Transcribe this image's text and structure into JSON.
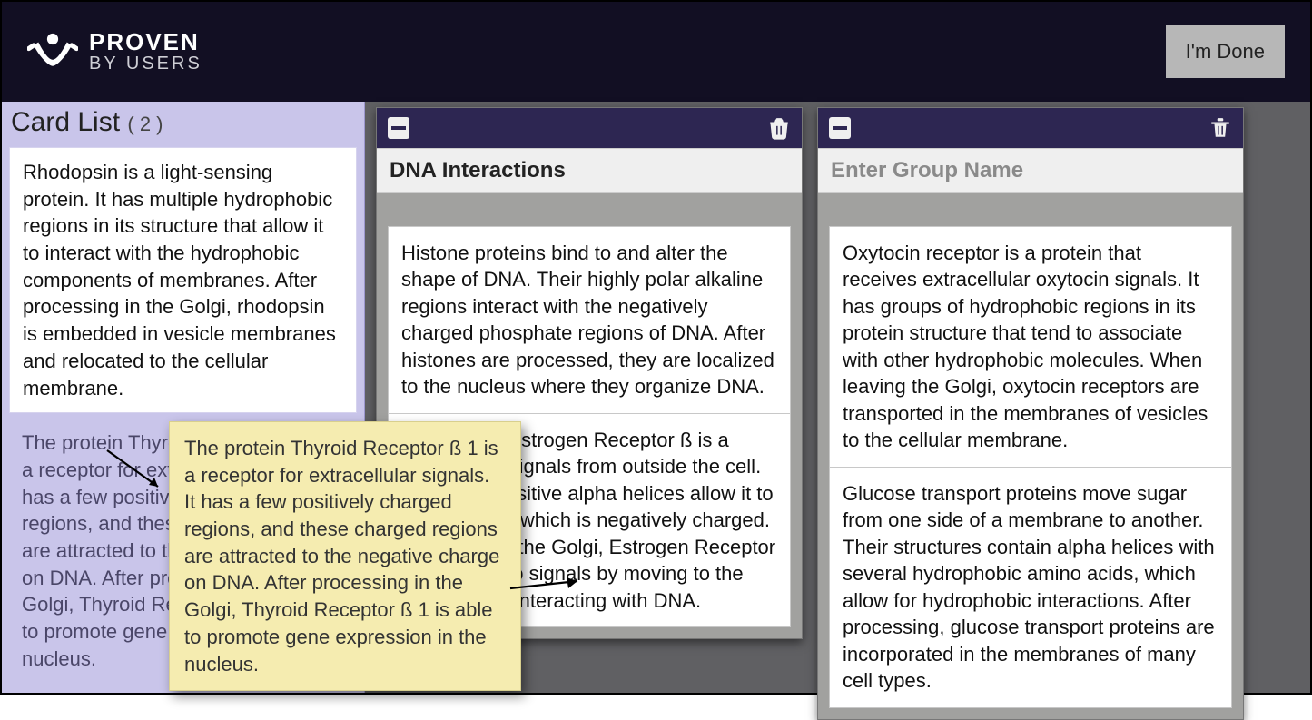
{
  "header": {
    "brand_top": "PROVEN",
    "brand_bottom": "BY USERS",
    "done_label": "I'm Done"
  },
  "sidebar": {
    "title": "Card List",
    "count_label": "( 2 )",
    "cards": [
      "Rhodopsin is a light-sensing protein. It has multiple hydrophobic regions in its structure that allow it to interact with the hydrophobic components of membranes. After processing in the Golgi, rhodopsin is embedded in vesicle membranes and relocated to the cellular membrane.",
      "The protein Thyroid Receptor ß 1 is a receptor for extracellular signals. It has a few positively charged regions, and these charged regions are attracted to the negative charge on DNA. After processing in the Golgi, Thyroid Receptor ß 1 is able to promote gene expression in the nucleus."
    ]
  },
  "groups": [
    {
      "title": "DNA Interactions",
      "is_placeholder": false,
      "cards": [
        "Histone proteins bind to and alter the shape of DNA. Their highly polar alkaline regions interact with the negatively charged phosphate regions of DNA. After histones are processed, they are localized to the nucleus where they organize DNA.",
        "The protein Estrogen Receptor ß is a receptor for signals from outside the cell. Its slightly positive alpha helices allow it to bind to DNA, which is negatively charged. After leaving the Golgi, Estrogen Receptor ß responds to signals by moving to the nucleus and interacting with DNA."
      ]
    },
    {
      "title": "Enter Group Name",
      "is_placeholder": true,
      "cards": [
        "Oxytocin receptor is a protein that receives extracellular oxytocin signals. It has groups of hydrophobic regions in its protein structure that tend to associate with other hydrophobic molecules. When leaving the Golgi, oxytocin receptors are transported in the membranes of vesicles to the cellular membrane.",
        "Glucose transport proteins move sugar from one side of a membrane to another. Their structures contain alpha helices with several hydrophobic amino acids, which allow for hydrophobic interactions. After processing, glucose transport proteins are incorporated in the membranes of many cell types."
      ]
    }
  ],
  "drag_card": {
    "text": "The protein Thyroid Receptor ß 1 is a receptor for extracellular signals. It has a few positively charged regions, and these charged regions are attracted to the negative charge on DNA. After processing in the Golgi, Thyroid Receptor ß 1 is able to promote gene expression in the nucleus."
  },
  "icons": {
    "collapse": "collapse-icon",
    "trash": "trash-icon",
    "logo": "logo-icon"
  }
}
